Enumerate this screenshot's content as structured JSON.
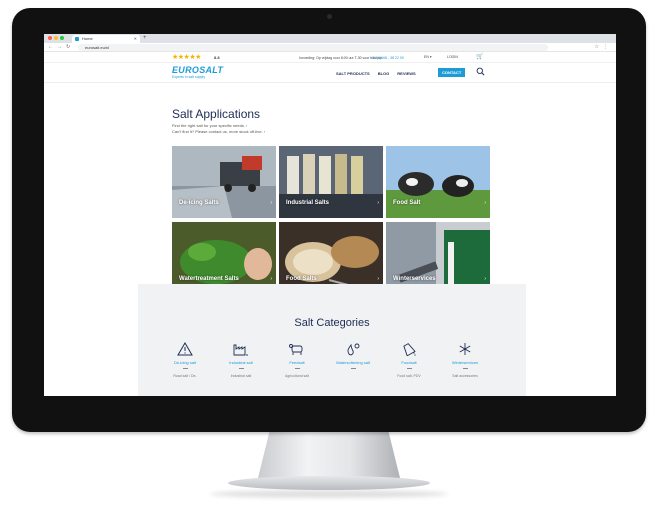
{
  "browser": {
    "tab_title": "Home",
    "url": "eurosalt.eu/nl"
  },
  "topbar": {
    "rating": "8.8",
    "promo": "Invoeding: Op vrijdag voor 8:00 uur T-30 voor kantoor",
    "phone": "+31 (0)168 - 38 22 00",
    "language": "EN ▾",
    "login": "LOGIN"
  },
  "header": {
    "logo": "EUROSALT",
    "tagline": "Experts in salt supply",
    "nav": [
      "SALT PRODUCTS",
      "BLOG",
      "REVIEWS"
    ],
    "contact": "CONTACT"
  },
  "main": {
    "title": "Salt Applications",
    "subtitle1": "Find the right salt for your specific needs. ›",
    "subtitle2": "Can't find it? Please contact us, more stock off-line. ›",
    "tiles": [
      "De-icing Salts",
      "Industrial Salts",
      "Food Salt",
      "Watertreatment Salts",
      "Food Salts",
      "Winterservices"
    ]
  },
  "categories": {
    "title": "Salt Categories",
    "items": [
      {
        "label": "De-icing salt",
        "sub": "Road salt / De-"
      },
      {
        "label": "Industrial salt",
        "sub": "Industrial salt"
      },
      {
        "label": "Feedsalt",
        "sub": "Agricultural salt"
      },
      {
        "label": "Watersoftening salt",
        "sub": ""
      },
      {
        "label": "Foodsalt",
        "sub": "Food salt, PDV"
      },
      {
        "label": "Winterservices",
        "sub": "Salt accessories"
      }
    ]
  },
  "colors": {
    "brand": "#1d9bd7",
    "navy": "#1f2d55",
    "star": "#f3b400",
    "panel": "#f1f2f4"
  }
}
